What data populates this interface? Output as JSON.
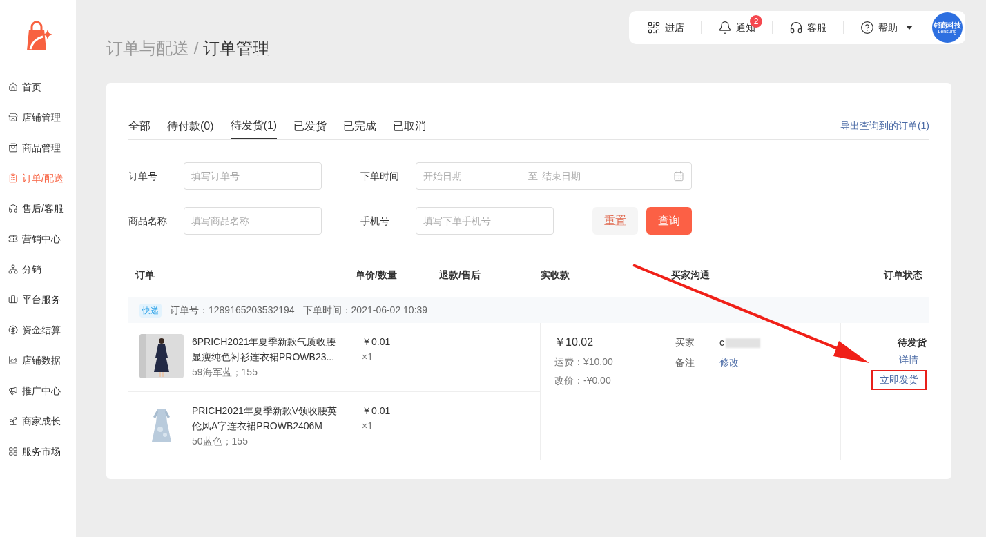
{
  "sidebar": {
    "items": [
      {
        "label": "首页",
        "selected": false
      },
      {
        "label": "店铺管理",
        "selected": false
      },
      {
        "label": "商品管理",
        "selected": false
      },
      {
        "label": "订单/配送",
        "selected": true
      },
      {
        "label": "售后/客服",
        "selected": false
      },
      {
        "label": "营销中心",
        "selected": false
      },
      {
        "label": "分销",
        "selected": false
      },
      {
        "label": "平台服务",
        "selected": false
      },
      {
        "label": "资金结算",
        "selected": false
      },
      {
        "label": "店铺数据",
        "selected": false
      },
      {
        "label": "推广中心",
        "selected": false
      },
      {
        "label": "商家成长",
        "selected": false
      },
      {
        "label": "服务市场",
        "selected": false
      }
    ]
  },
  "topbar": {
    "items": [
      {
        "label": "进店",
        "kind": "qr"
      },
      {
        "label": "通知",
        "kind": "bell",
        "badge": "2"
      },
      {
        "label": "客服",
        "kind": "headset"
      },
      {
        "label": "帮助",
        "kind": "help"
      }
    ],
    "avatar": {
      "title": "邻商科技",
      "subtitle": "Lensung"
    }
  },
  "breadcrumb": {
    "parent": "订单与配送",
    "separator": "/",
    "current": "订单管理"
  },
  "tabs": [
    {
      "label": "全部",
      "selected": false
    },
    {
      "label": "待付款(0)",
      "selected": false
    },
    {
      "label": "待发货(1)",
      "selected": true
    },
    {
      "label": "已发货",
      "selected": false
    },
    {
      "label": "已完成",
      "selected": false
    },
    {
      "label": "已取消",
      "selected": false
    }
  ],
  "export_link": "导出查询到的订单(1)",
  "filters": {
    "order_no": {
      "label": "订单号",
      "placeholder": "填写订单号"
    },
    "order_time": {
      "label": "下单时间",
      "start_placeholder": "开始日期",
      "separator": "至",
      "end_placeholder": "结束日期"
    },
    "product_name": {
      "label": "商品名称",
      "placeholder": "填写商品名称"
    },
    "phone": {
      "label": "手机号",
      "placeholder": "填写下单手机号"
    },
    "reset": "重置",
    "query": "查询"
  },
  "table": {
    "columns": [
      "订单",
      "单价/数量",
      "退款/售后",
      "实收款",
      "买家沟通",
      "订单状态"
    ],
    "orders": [
      {
        "delivery_tag": "快递",
        "order_no": "订单号：1289165203532194",
        "order_time": "下单时间：2021-06-02 10:39",
        "items": [
          {
            "title": "6PRICH2021年夏季新款气质收腰显瘦纯色衬衫连衣裙PROWB23...",
            "spec": "59海军蓝；155",
            "price": "￥0.01",
            "qty": "×1",
            "kind": "navy"
          },
          {
            "title": "PRICH2021年夏季新款V领收腰英伦风A字连衣裙PROWB2406M",
            "spec": "50蓝色；155",
            "price": "￥0.01",
            "qty": "×1",
            "kind": "floral"
          }
        ],
        "amount": "￥10.02",
        "shipping": "运费：¥10.00",
        "adjustment": "改价：-¥0.00",
        "buyer_label": "买家",
        "buyer": "c",
        "remark_label": "备注",
        "remark_action": "修改",
        "status": "待发货",
        "actions": [
          "详情",
          "立即发货"
        ]
      }
    ]
  }
}
